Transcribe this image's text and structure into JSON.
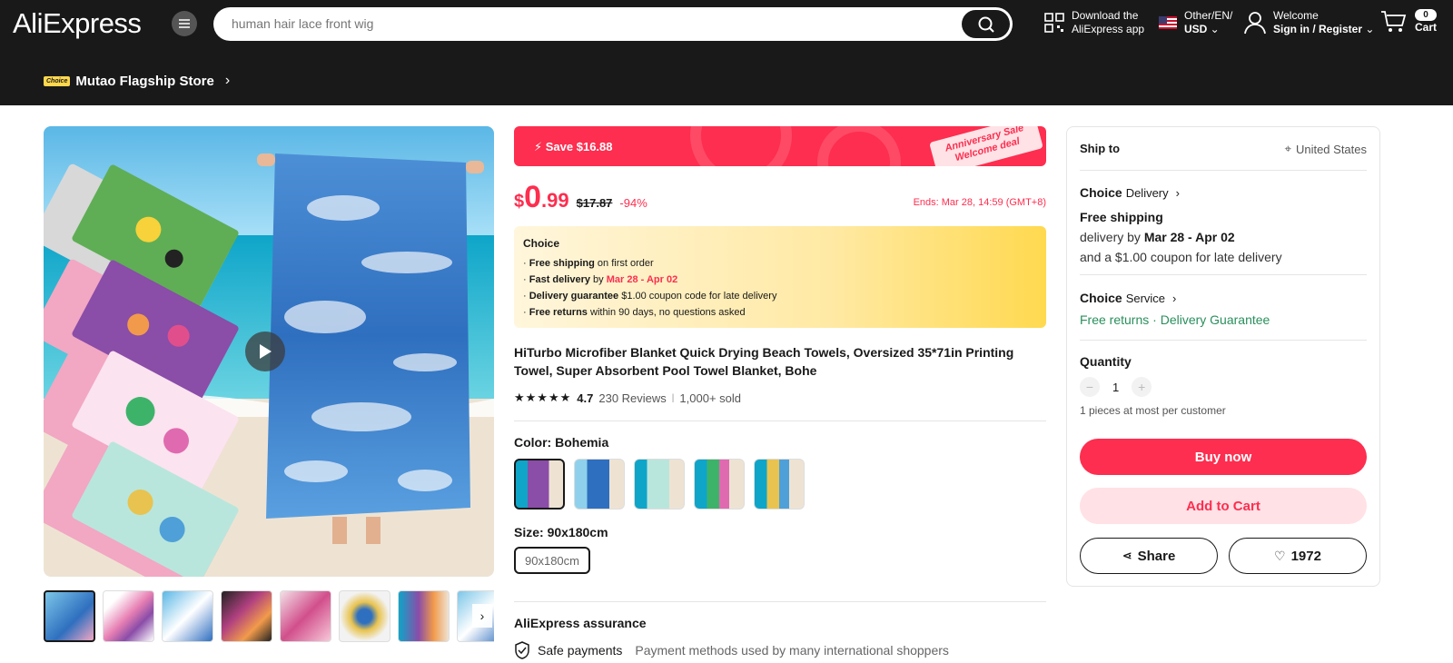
{
  "header": {
    "logo": "AliExpress",
    "search_placeholder": "human hair lace front wig",
    "app_line1": "Download the",
    "app_line2": "AliExpress app",
    "region_line1": "Other/EN/",
    "region_line2": "USD",
    "welcome_line1": "Welcome",
    "welcome_line2": "Sign in / Register",
    "cart_count": "0",
    "cart_label": "Cart"
  },
  "store": {
    "badge": "Choice",
    "name": "Mutao Flagship Store"
  },
  "promo": {
    "save": "Save $16.88",
    "tag_line1": "Anniversary Sale",
    "tag_line2": "Welcome deal"
  },
  "price": {
    "currency": "$",
    "integer": "0",
    "decimal": ".99",
    "original": "$17.87",
    "discount": "-94%",
    "ends": "Ends: Mar 28, 14:59 (GMT+8)"
  },
  "choice_box": {
    "title": "Choice",
    "l1_bold": "Free shipping",
    "l1_rest": " on first order",
    "l2_bold": "Fast delivery",
    "l2_mid": " by ",
    "l2_red": "Mar 28 - Apr 02",
    "l3_bold": "Delivery guarantee",
    "l3_rest": "  $1.00 coupon code for late delivery",
    "l4_bold": "Free returns",
    "l4_rest": "  within 90 days, no questions asked"
  },
  "product": {
    "title": "HiTurbo Microfiber Blanket Quick Drying Beach Towels, Oversized 35*71in Printing Towel, Super Absorbent Pool Towel Blanket, Bohe",
    "rating": "4.7",
    "reviews": "230 Reviews",
    "sold": "1,000+ sold",
    "color_label": "Color: Bohemia",
    "size_label": "Size: 90x180cm",
    "size_option": "90x180cm"
  },
  "assurance": {
    "title": "AliExpress assurance",
    "safe": "Safe payments",
    "safe_desc": "Payment methods used by many international shoppers"
  },
  "panel": {
    "ship_to": "Ship to",
    "country": "United States",
    "delivery_choice": "Choice",
    "delivery_label": "Delivery",
    "free_shipping": "Free shipping",
    "delivery_by": "delivery by ",
    "delivery_dates": "Mar 28 - Apr 02",
    "coupon": "and a $1.00 coupon for late delivery",
    "service_choice": "Choice",
    "service_label": "Service",
    "free_returns": "Free returns",
    "dot": " · ",
    "guarantee": "Delivery Guarantee",
    "quantity_label": "Quantity",
    "quantity": "1",
    "limit": "1 pieces at most per customer",
    "buy_now": "Buy now",
    "add_to_cart": "Add to Cart",
    "share": "Share",
    "wish_count": "1972"
  },
  "colors": {
    "accent": "#fd2e4f",
    "header_bg": "#191919",
    "green": "#2a8f5c"
  }
}
